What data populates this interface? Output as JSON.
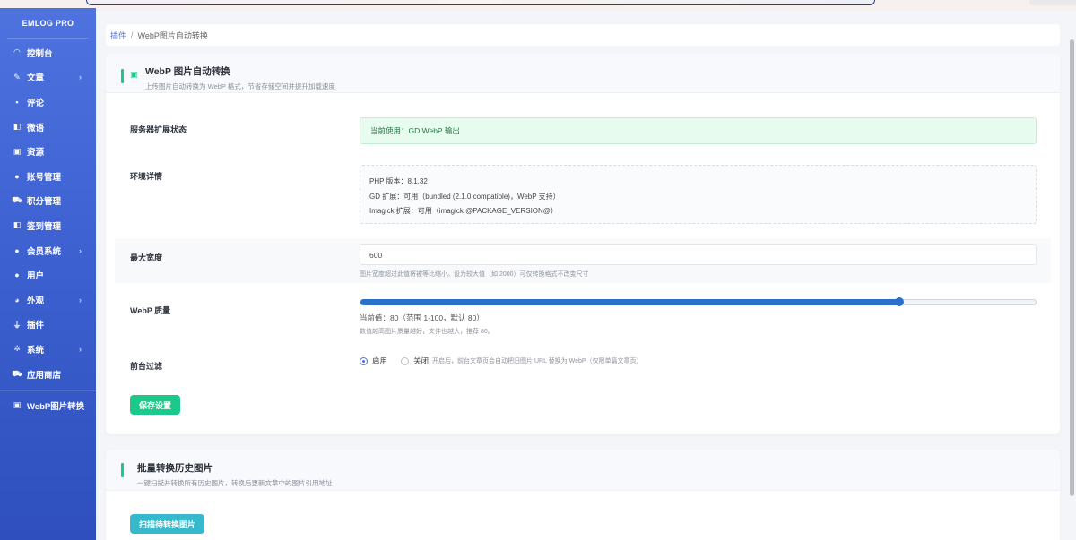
{
  "brand": "EMLOG PRO",
  "sidebar": {
    "items": [
      {
        "label": "控制台",
        "icon": "speedometer-icon",
        "glyph": "◠",
        "chevron": false
      },
      {
        "label": "文章",
        "icon": "pencil-icon",
        "glyph": "✎",
        "chevron": true
      },
      {
        "label": "评论",
        "icon": "comment-icon",
        "glyph": "▪",
        "chevron": false
      },
      {
        "label": "微语",
        "icon": "megaphone-icon",
        "glyph": "◧",
        "chevron": false
      },
      {
        "label": "资源",
        "icon": "image-icon",
        "glyph": "▣",
        "chevron": false
      },
      {
        "label": "账号管理",
        "icon": "user-icon",
        "glyph": "●",
        "chevron": false
      },
      {
        "label": "积分管理",
        "icon": "cart-icon",
        "glyph": "⛟",
        "chevron": false
      },
      {
        "label": "签到管理",
        "icon": "megaphone-icon",
        "glyph": "◧",
        "chevron": false
      },
      {
        "label": "会员系统",
        "icon": "user-icon",
        "glyph": "●",
        "chevron": true
      },
      {
        "label": "用户",
        "icon": "user-icon",
        "glyph": "●",
        "chevron": false
      },
      {
        "label": "外观",
        "icon": "palette-icon",
        "glyph": "◕",
        "chevron": true
      },
      {
        "label": "插件",
        "icon": "plug-icon",
        "glyph": "⏚",
        "chevron": false
      },
      {
        "label": "系统",
        "icon": "gear-icon",
        "glyph": "✲",
        "chevron": true
      },
      {
        "label": "应用商店",
        "icon": "cart-icon",
        "glyph": "⛟",
        "chevron": false
      }
    ],
    "webp_item": {
      "label": "WebP图片转换",
      "icon": "image-icon",
      "glyph": "▣"
    }
  },
  "breadcrumb": {
    "parent": "插件",
    "separator": "/",
    "current": "WebP图片自动转换"
  },
  "settings_card": {
    "title": "WebP 图片自动转换",
    "subtitle": "上传图片自动转换为 WebP 格式，节省存储空间并提升加载速度",
    "server_status": {
      "label": "服务器扩展状态",
      "value": "当前使用：GD WebP 输出"
    },
    "environment": {
      "label": "环境详情",
      "lines": [
        "PHP 版本：8.1.32",
        "GD 扩展：可用（bundled (2.1.0 compatible)，WebP 支持）",
        "Imagick 扩展：可用（imagick @PACKAGE_VERSION@）"
      ]
    },
    "max_width": {
      "label": "最大宽度",
      "value": "600",
      "help": "图片宽度超过此值将被等比缩小。设为较大值（如 2000）可仅转换格式不改变尺寸"
    },
    "quality": {
      "label": "WebP 质量",
      "value": 80,
      "min": 1,
      "max": 100,
      "current_text": "当前值：80（范围 1-100，默认 80）",
      "help": "数值越高图片质量越好，文件也越大，推荐 80。"
    },
    "frontend_filter": {
      "label": "前台过滤",
      "on_label": "启用",
      "off_label": "关闭",
      "selected": "on",
      "help": "开启后，前台文章页会自动把旧图片 URL 替换为 WebP（仅限单篇文章页）"
    },
    "save_label": "保存设置"
  },
  "batch_card": {
    "title": "批量转换历史图片",
    "subtitle": "一键扫描并转换所有历史图片，转换后更新文章中的图片引用地址",
    "scan_label": "扫描待转换图片"
  },
  "colors": {
    "sidebar": "#4e73df",
    "accent_green": "#1cc88a",
    "info_teal": "#36b9cc",
    "slider_blue": "#2a6fc9"
  }
}
